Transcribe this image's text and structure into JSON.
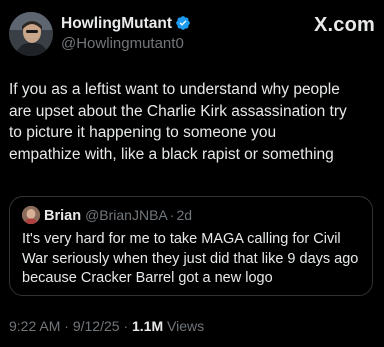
{
  "author": {
    "display_name": "HowlingMutant",
    "handle": "@Howlingmutant0",
    "verified_color": "#1d9bf0"
  },
  "brand": {
    "label": "X.com"
  },
  "tweet": {
    "text": "If you as a leftist want to understand why people\nare upset about the Charlie Kirk assassination try\nto picture it happening to someone you\nempathize with, like a black rapist or something"
  },
  "quote": {
    "display_name": "Brian",
    "handle": "@BrianJNBA",
    "separator": "·",
    "time": "2d",
    "text": "It's very hard for me to take MAGA calling for Civil\nWar seriously when they just did that like 9 days ago\nbecause Cracker Barrel got a new logo"
  },
  "meta": {
    "time": "9:22 AM",
    "separator": "·",
    "date": "9/12/25",
    "views_count": "1.1M",
    "views_label": "Views"
  },
  "colors": {
    "background": "#000000",
    "text_primary": "#e7e9ea",
    "text_secondary": "#71767b",
    "border": "#2f3336",
    "verified_blue": "#1d9bf0"
  },
  "icons": {
    "verified": "verified-badge-icon"
  }
}
